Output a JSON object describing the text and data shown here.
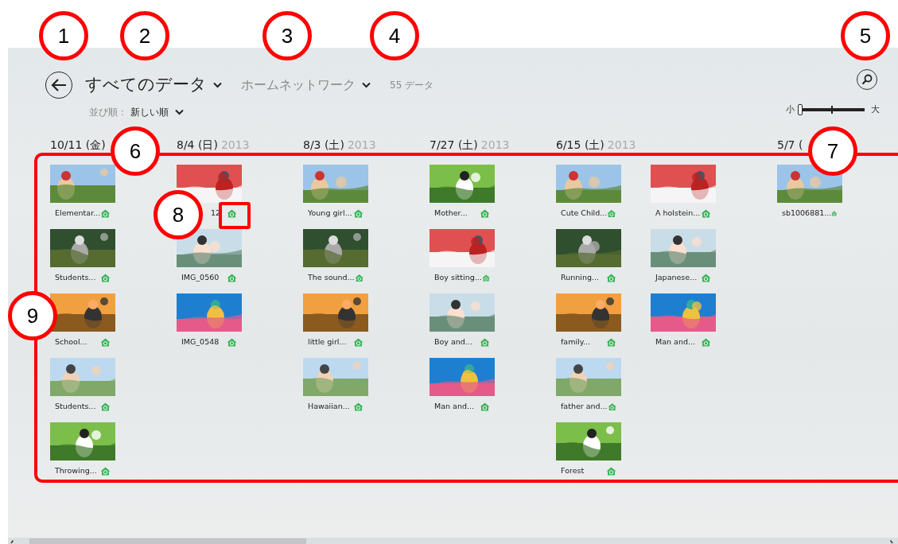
{
  "header": {
    "title": "すべてのデータ",
    "source": "ホームネットワーク",
    "count": "55 データ",
    "sort_label": "並び順：",
    "sort_value": "新しい順"
  },
  "zoom_slider": {
    "min_label": "小",
    "max_label": "大",
    "level": 0
  },
  "groups": [
    {
      "date": "10/11 (金)",
      "items": [
        {
          "caption": "Elementar..."
        },
        {
          "caption": "Students..."
        },
        {
          "caption": "School..."
        },
        {
          "caption": "Students..."
        },
        {
          "caption": "Throwing..."
        }
      ]
    },
    {
      "date": "8/4 (日)",
      "year": "2013",
      "items": [
        {
          "caption": "12",
          "kind": "cut"
        },
        {
          "caption": "IMG_0560"
        },
        {
          "caption": "IMG_0548"
        }
      ]
    },
    {
      "date": "8/3 (土)",
      "year": "2013",
      "items": [
        {
          "caption": "Young girl..."
        },
        {
          "caption": "The sound..."
        },
        {
          "caption": "little girl..."
        },
        {
          "caption": "Hawaiian..."
        }
      ]
    },
    {
      "date": "7/27 (土)",
      "year": "2013",
      "items": [
        {
          "caption": "Mother..."
        },
        {
          "caption": "Boy sitting..."
        },
        {
          "caption": "Boy and..."
        },
        {
          "caption": "Man and..."
        }
      ]
    },
    {
      "date": "6/15 (土)",
      "year": "2013",
      "items": [
        {
          "caption": "Cute Child..."
        },
        {
          "caption": "Running..."
        },
        {
          "caption": "family..."
        },
        {
          "caption": "father and..."
        },
        {
          "caption": "Forest"
        },
        {
          "caption": "A holstein..."
        },
        {
          "caption": "Japanese..."
        },
        {
          "caption": "Man and..."
        }
      ]
    },
    {
      "date": "5/7 (",
      "items": [
        {
          "caption": "sb1006881..."
        }
      ]
    }
  ],
  "annotations": [
    {
      "number": "1"
    },
    {
      "number": "2"
    },
    {
      "number": "3"
    },
    {
      "number": "4"
    },
    {
      "number": "5"
    },
    {
      "number": "6"
    },
    {
      "number": "7"
    },
    {
      "number": "8"
    },
    {
      "number": "9"
    }
  ]
}
